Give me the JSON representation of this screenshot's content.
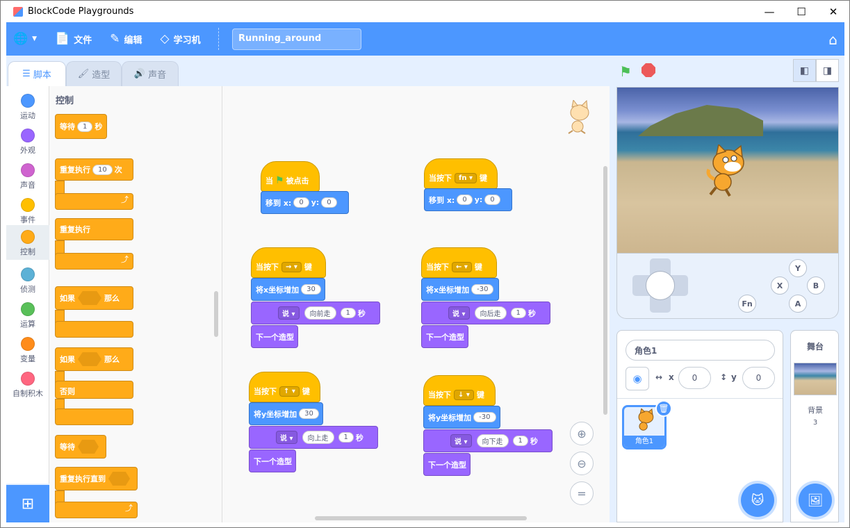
{
  "window": {
    "title": "BlockCode Playgrounds",
    "minimize": "—",
    "maximize": "☐",
    "close": "✕"
  },
  "menu": {
    "file": "文件",
    "edit": "编辑",
    "learn": "学习机",
    "project_name": "Running_around"
  },
  "tabs": {
    "code": "脚本",
    "costumes": "造型",
    "sounds": "声音"
  },
  "categories": [
    {
      "label": "运动",
      "color": "#4c97ff"
    },
    {
      "label": "外观",
      "color": "#9966ff"
    },
    {
      "label": "声音",
      "color": "#cf63cf"
    },
    {
      "label": "事件",
      "color": "#ffbf00"
    },
    {
      "label": "控制",
      "color": "#ffab19"
    },
    {
      "label": "侦测",
      "color": "#5cb1d6"
    },
    {
      "label": "运算",
      "color": "#59c059"
    },
    {
      "label": "变量",
      "color": "#ff8c1a"
    },
    {
      "label": "自制积木",
      "color": "#ff6680"
    }
  ],
  "palette": {
    "title": "控制",
    "wait": "等待",
    "wait_val": "1",
    "sec": "秒",
    "repeat": "重复执行",
    "repeat_val": "10",
    "times": "次",
    "forever": "重复执行",
    "if": "如果",
    "then": "那么",
    "if2": "如果",
    "then2": "那么",
    "else": "否则",
    "wait_until": "等待",
    "repeat_until": "重复执行直到"
  },
  "scripts": {
    "s1": {
      "when": "当",
      "clicked": "被点击",
      "goto": "移到 x:",
      "x": "0",
      "y_label": "y:",
      "y": "0"
    },
    "s2": {
      "when_key": "当按下",
      "key": "fn",
      "key_suffix": "键",
      "goto": "移到 x:",
      "x": "0",
      "y_label": "y:",
      "y": "0"
    },
    "s3": {
      "when_key": "当按下",
      "key": "→",
      "key_suffix": "键",
      "change": "将x坐标增加",
      "val": "30",
      "say": "说",
      "msg": "向前走",
      "secs": "1",
      "sec": "秒",
      "next": "下一个造型"
    },
    "s4": {
      "when_key": "当按下",
      "key": "←",
      "key_suffix": "键",
      "change": "将x坐标增加",
      "val": "-30",
      "say": "说",
      "msg": "向后走",
      "secs": "1",
      "sec": "秒",
      "next": "下一个造型"
    },
    "s5": {
      "when_key": "当按下",
      "key": "↑",
      "key_suffix": "键",
      "change": "将y坐标增加",
      "val": "30",
      "say": "说",
      "msg": "向上走",
      "secs": "1",
      "sec": "秒",
      "next": "下一个造型"
    },
    "s6": {
      "when_key": "当按下",
      "key": "↓",
      "key_suffix": "键",
      "change": "将y坐标增加",
      "val": "-30",
      "say": "说",
      "msg": "向下走",
      "secs": "1",
      "sec": "秒",
      "next": "下一个造型"
    }
  },
  "gamepad": {
    "y": "Y",
    "x": "X",
    "b": "B",
    "a": "A",
    "fn": "Fn"
  },
  "sprite": {
    "name": "角色1",
    "x_label": "x",
    "x": "0",
    "y_label": "y",
    "y": "0",
    "tile_label": "角色1"
  },
  "stage_panel": {
    "title": "舞台",
    "backdrop_label": "背景",
    "backdrop_count": "3"
  }
}
